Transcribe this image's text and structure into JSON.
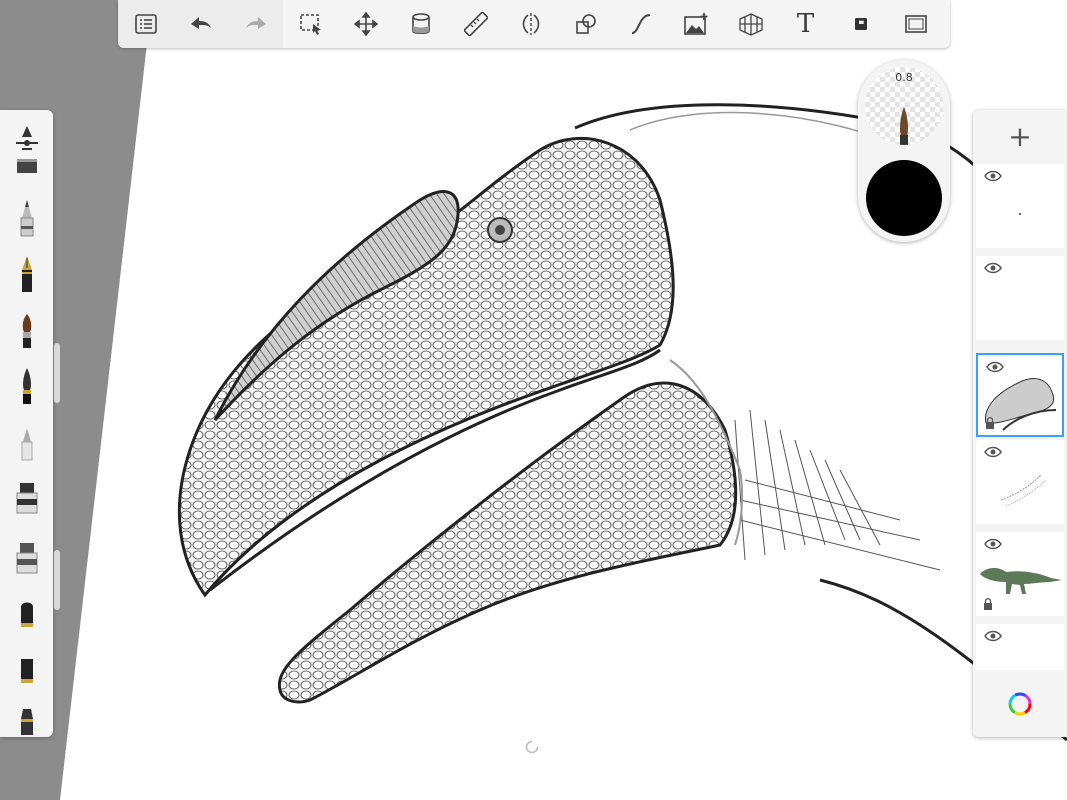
{
  "toolbar": {
    "items": [
      {
        "name": "brush-list-icon"
      },
      {
        "name": "undo-icon"
      },
      {
        "name": "redo-icon"
      },
      {
        "name": "selection-icon"
      },
      {
        "name": "transform-icon"
      },
      {
        "name": "fill-icon"
      },
      {
        "name": "ruler-icon"
      },
      {
        "name": "symmetry-icon"
      },
      {
        "name": "shape-icon"
      },
      {
        "name": "curve-icon"
      },
      {
        "name": "image-icon"
      },
      {
        "name": "perspective-icon"
      },
      {
        "name": "text-icon",
        "label": "T"
      },
      {
        "name": "layer-mode-icon"
      },
      {
        "name": "fullscreen-icon"
      }
    ]
  },
  "brushes": [
    {
      "name": "brush-settings"
    },
    {
      "name": "brush-airbrush"
    },
    {
      "name": "brush-pencil"
    },
    {
      "name": "brush-fountain-pen"
    },
    {
      "name": "brush-paintbrush"
    },
    {
      "name": "brush-ink-brush"
    },
    {
      "name": "brush-eraser"
    },
    {
      "name": "brush-marker-1"
    },
    {
      "name": "brush-marker-2"
    },
    {
      "name": "brush-chisel-1"
    },
    {
      "name": "brush-chisel-2"
    },
    {
      "name": "brush-chisel-3"
    }
  ],
  "puck": {
    "size_label": "0.8",
    "color": "#000000"
  },
  "layers": {
    "add_label": "+",
    "items": [
      {
        "name": "layer-1",
        "visible": true,
        "active": false
      },
      {
        "name": "layer-2",
        "visible": true,
        "active": false
      },
      {
        "name": "layer-3",
        "visible": true,
        "active": true
      },
      {
        "name": "layer-4",
        "visible": true,
        "active": false
      },
      {
        "name": "layer-5",
        "visible": true,
        "active": false
      },
      {
        "name": "layer-6",
        "visible": true,
        "active": false
      }
    ]
  },
  "colors": {
    "accent": "#3aa0ff",
    "toolbar_bg": "#f4f4f4",
    "canvas_bg": "#ffffff",
    "outside_bg": "#8c8c8c"
  }
}
